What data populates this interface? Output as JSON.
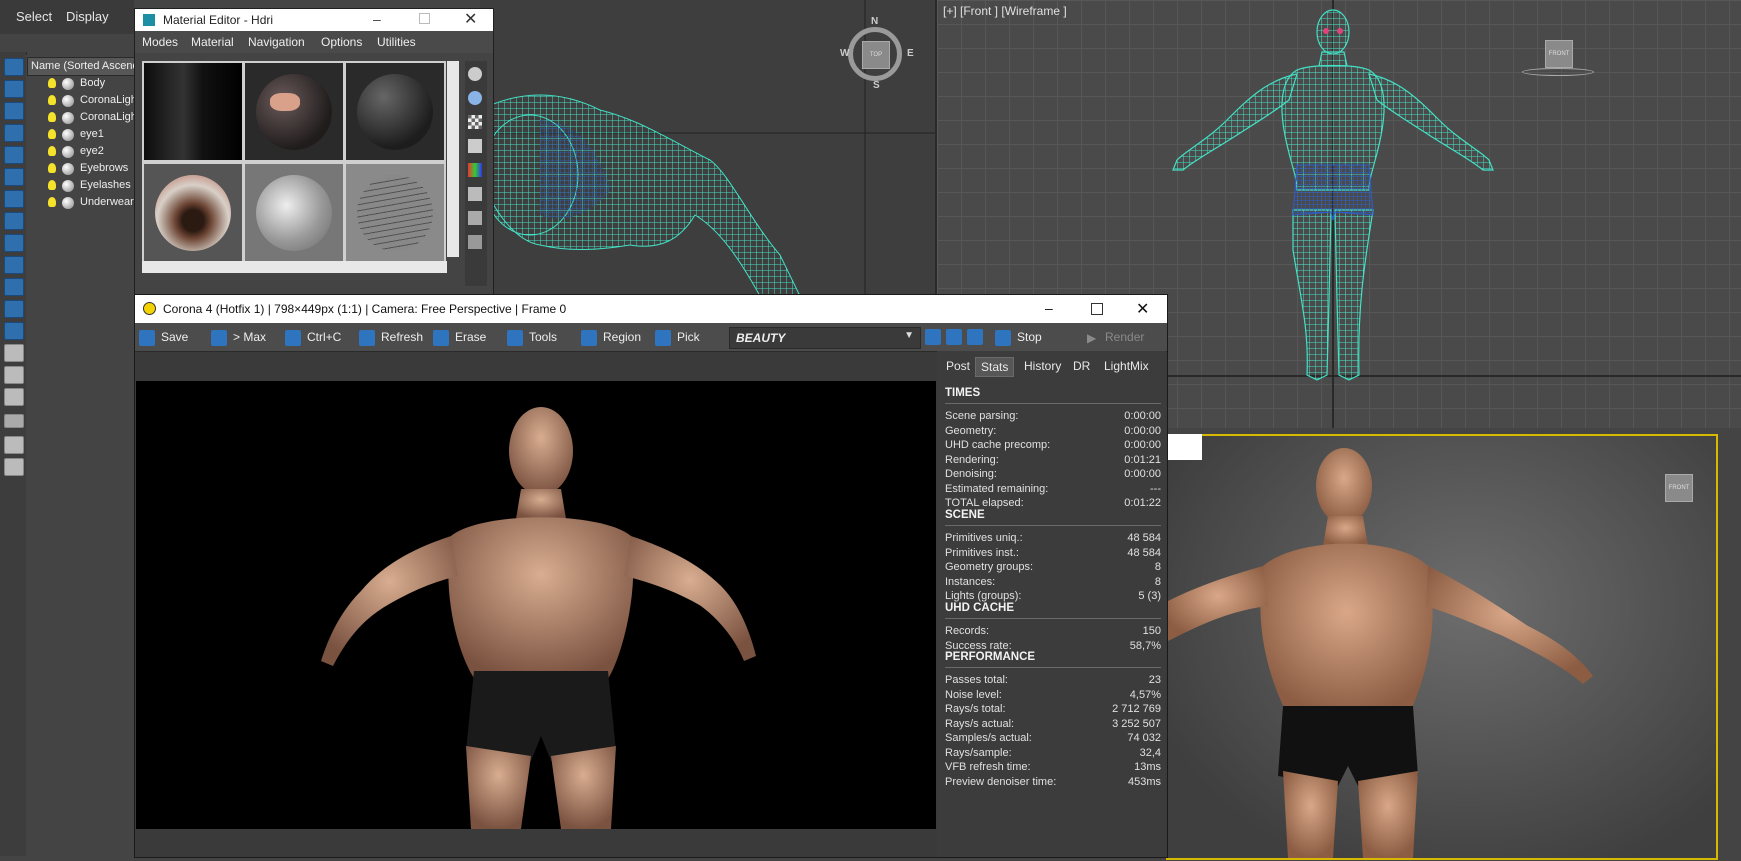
{
  "main_menu": {
    "select": "Select",
    "display": "Display"
  },
  "explorer": {
    "header": "Name (Sorted Ascending)",
    "items": [
      "Body",
      "CoronaLight",
      "CoronaLight",
      "eye1",
      "eye2",
      "Eyebrows",
      "Eyelashes",
      "Underwear"
    ]
  },
  "material_editor": {
    "title": "Material Editor - Hdri",
    "menu": [
      "Modes",
      "Material",
      "Navigation",
      "Options",
      "Utilities"
    ]
  },
  "viewport_front": {
    "label": "[+] [Front ] [Wireframe ]"
  },
  "viewcube": {
    "top": "TOP",
    "front": "FRONT",
    "n": "N",
    "s": "S",
    "e": "E",
    "w": "W"
  },
  "vfb": {
    "title": "Corona 4 (Hotfix 1) | 798×449px (1:1) | Camera: Free Perspective | Frame 0",
    "toolbar": {
      "save": "Save",
      "max": "> Max",
      "copy": "Ctrl+C",
      "refresh": "Refresh",
      "erase": "Erase",
      "tools": "Tools",
      "region": "Region",
      "pick": "Pick",
      "channel": "BEAUTY",
      "stop": "Stop",
      "render": "Render"
    },
    "tabs": [
      "Post",
      "Stats",
      "History",
      "DR",
      "LightMix"
    ],
    "active_tab": "Stats",
    "stats": {
      "times_title": "TIMES",
      "times": [
        {
          "k": "Scene parsing:",
          "v": "0:00:00"
        },
        {
          "k": "Geometry:",
          "v": "0:00:00"
        },
        {
          "k": "UHD cache precomp:",
          "v": "0:00:00"
        },
        {
          "k": "Rendering:",
          "v": "0:01:21"
        },
        {
          "k": "Denoising:",
          "v": "0:00:00"
        },
        {
          "k": "Estimated remaining:",
          "v": "---"
        },
        {
          "k": "TOTAL elapsed:",
          "v": "0:01:22"
        }
      ],
      "scene_title": "SCENE",
      "scene": [
        {
          "k": "Primitives uniq.:",
          "v": "48 584"
        },
        {
          "k": "Primitives inst.:",
          "v": "48 584"
        },
        {
          "k": "Geometry groups:",
          "v": "8"
        },
        {
          "k": "Instances:",
          "v": "8"
        },
        {
          "k": "Lights (groups):",
          "v": "5 (3)"
        }
      ],
      "uhd_title": "UHD CACHE",
      "uhd": [
        {
          "k": "Records:",
          "v": "150"
        },
        {
          "k": "Success rate:",
          "v": "58,7%"
        }
      ],
      "perf_title": "PERFORMANCE",
      "perf": [
        {
          "k": "Passes total:",
          "v": "23"
        },
        {
          "k": "Noise level:",
          "v": "4,57%"
        },
        {
          "k": "Rays/s total:",
          "v": "2 712 769"
        },
        {
          "k": "Rays/s actual:",
          "v": "3 252 507"
        },
        {
          "k": "Samples/s actual:",
          "v": "74 032"
        },
        {
          "k": "Rays/sample:",
          "v": "32,4"
        },
        {
          "k": "VFB refresh time:",
          "v": "13ms"
        },
        {
          "k": "Preview denoiser time:",
          "v": "453ms"
        }
      ]
    }
  },
  "colors": {
    "accent": "#2e74bf",
    "wire": "#43e0c4",
    "active_viewport": "#d9b800"
  }
}
